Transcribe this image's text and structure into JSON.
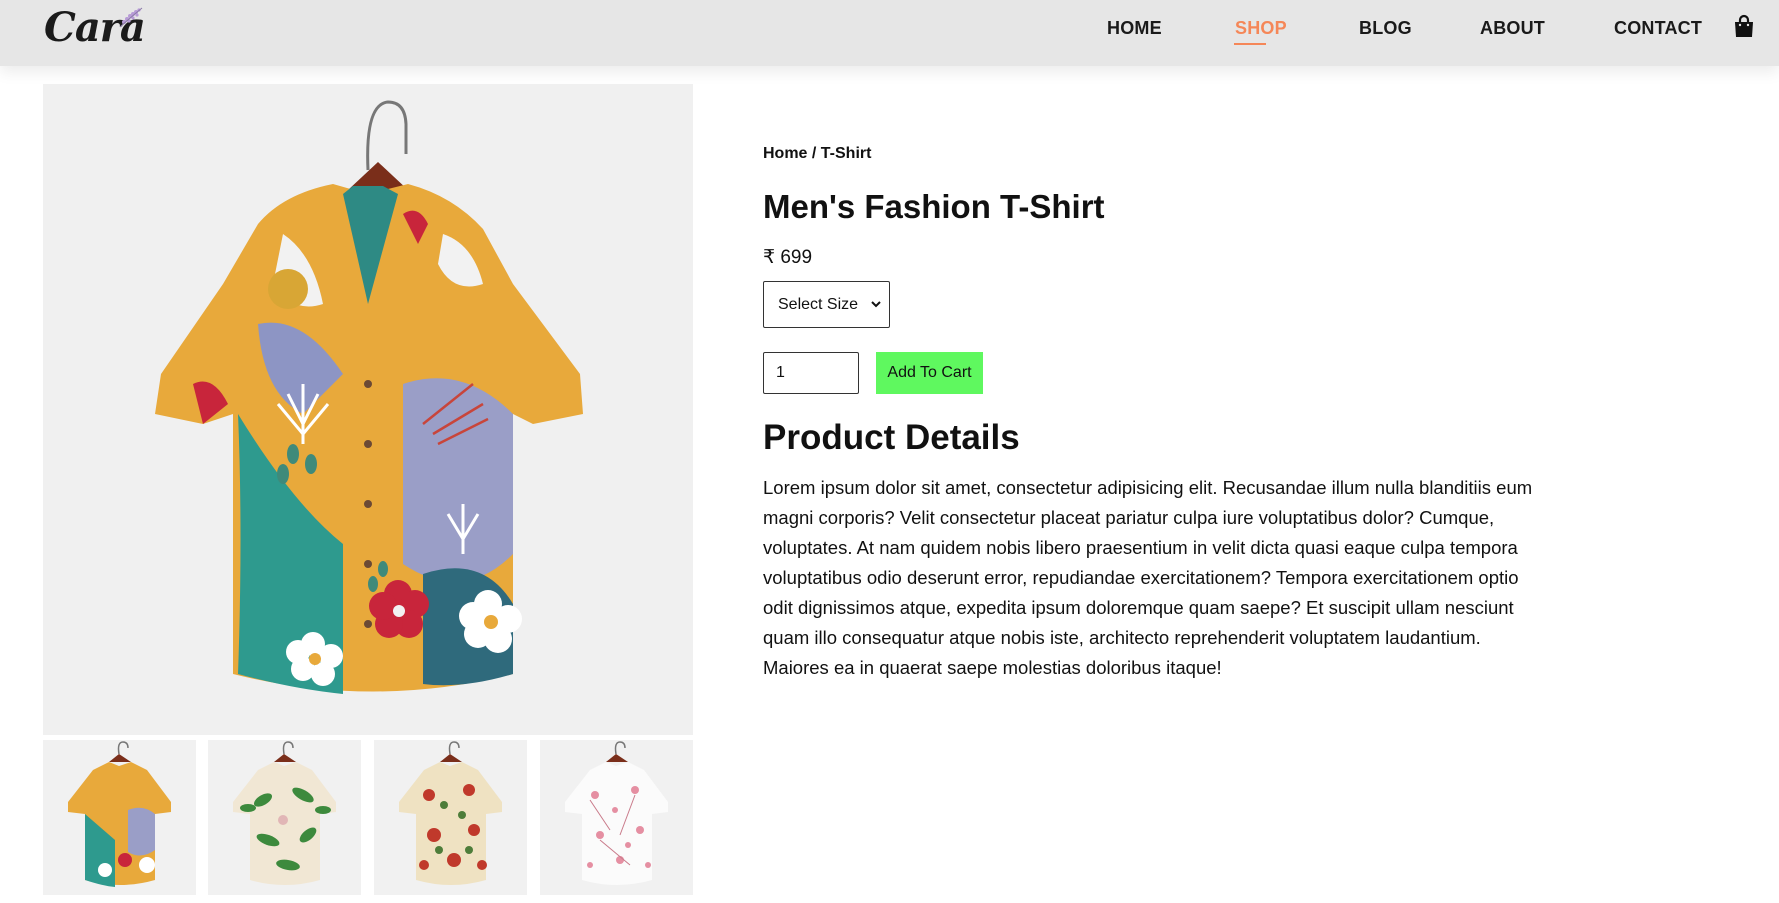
{
  "header": {
    "logo_text": "Cara",
    "nav": {
      "home": "HOME",
      "shop": "SHOP",
      "blog": "BLOG",
      "about": "ABOUT",
      "contact": "CONTACT"
    },
    "active_nav": "shop",
    "cart_icon": "shopping-bag-icon",
    "accent_color": "#f58758"
  },
  "product": {
    "breadcrumb": "Home / T-Shirt",
    "title": "Men's Fashion T-Shirt",
    "price": "₹ 699",
    "size_select": {
      "selected": "Select Size"
    },
    "quantity": "1",
    "add_to_cart_label": "Add To Cart",
    "add_to_cart_color": "#5ff85f",
    "details_heading": "Product Details",
    "details_text": "Lorem ipsum dolor sit amet, consectetur adipisicing elit. Recusandae illum nulla blanditiis eum magni corporis? Velit consectetur placeat pariatur culpa iure voluptatibus dolor? Cumque, voluptates. At nam quidem nobis libero praesentium in velit dicta quasi eaque culpa tempora voluptatibus odio deserunt error, repudiandae exercitationem? Tempora exercitationem optio odit dignissimos atque, expedita ipsum doloremque quam saepe? Et suscipit ullam nesciunt quam illo consequatur atque nobis iste, architecto reprehenderit voluptatem laudantium. Maiores ea in quaerat saepe molestias doloribus itaque!"
  },
  "gallery": {
    "main_image": "floral-shirt-image",
    "thumbnails": [
      "floral-shirt-thumb",
      "green-leaf-shirt-thumb",
      "red-floral-shirt-thumb",
      "pink-floral-shirt-thumb"
    ]
  }
}
